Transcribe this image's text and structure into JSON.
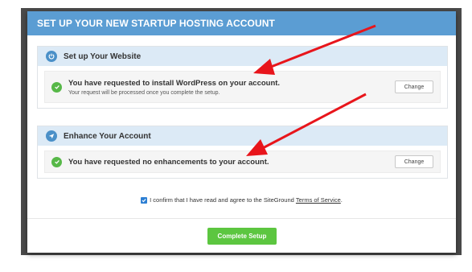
{
  "modal": {
    "title": "SET UP YOUR NEW STARTUP HOSTING ACCOUNT"
  },
  "website_section": {
    "heading": "Set up Your Website",
    "message": "You have requested to install WordPress on your account.",
    "submessage": "Your request will be processed once you complete the setup.",
    "change_label": "Change"
  },
  "enhance_section": {
    "heading": "Enhance Your Account",
    "message": "You have requested no enhancements to your account.",
    "change_label": "Change"
  },
  "confirm": {
    "checked": true,
    "text": "I confirm that I have read and agree to the SiteGround",
    "link_text": "Terms of Service",
    "suffix": "."
  },
  "footer": {
    "complete_label": "Complete Setup"
  },
  "colors": {
    "header": "#5b9dd3",
    "section_head": "#dceaf6",
    "check": "#57b848",
    "button": "#5cc640",
    "arrow": "#e8151b"
  }
}
